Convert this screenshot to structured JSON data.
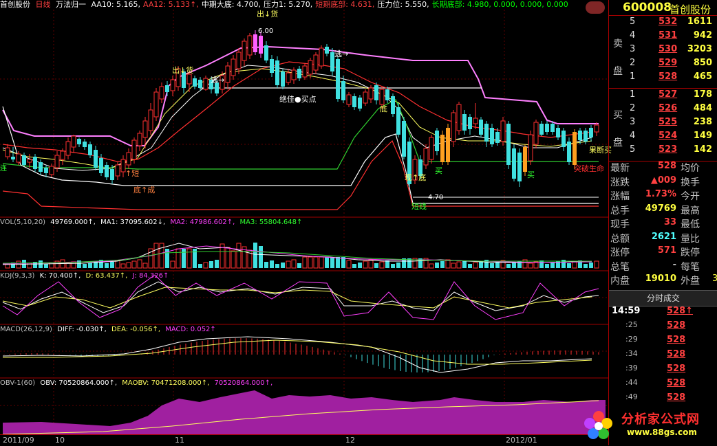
{
  "header": {
    "stock_name": "首创股份",
    "period": "日线",
    "indicator": "万法归一",
    "items": [
      {
        "label": "AA10: 5.165,",
        "color": "#ffffff"
      },
      {
        "label": "AA12: 5.133↑,",
        "color": "#ff4040"
      },
      {
        "label": "中期大底: 4.700,",
        "color": "#ffffff"
      },
      {
        "label": "压力1: 5.270,",
        "color": "#ffffff"
      },
      {
        "label": "短期底部: 4.631,",
        "color": "#ff4040"
      },
      {
        "label": "压力位: 5.550,",
        "color": "#ffffff"
      },
      {
        "label": "长期底部: 4.980, 0.000, 0.000, 0.000",
        "color": "#00ff00"
      }
    ]
  },
  "annotations": {
    "high_price": "6.00",
    "low_price": "4.70",
    "chu_huo_top": "出↓货",
    "chu_huo_left": "出↓货",
    "tao_1": "逃→",
    "tao_2": "逃→",
    "jue_jia": "绝佳●买点",
    "di_1": "底",
    "di_cheng": "底↑成",
    "zhen": "↑短",
    "di_2": "现↑底",
    "mai_1": "买",
    "mai_2": "买",
    "short_line": "短线",
    "guo_duan": "果断买",
    "tu_po": "突破生命",
    "left_edge": "连"
  },
  "vol_header": {
    "name": "VOL(5,10,20)",
    "value": "49769.000↑,",
    "ma1": "MA1: 37095.602↓,",
    "ma2": "MA2: 47986.602↑,",
    "ma3": "MA3: 55804.648↑"
  },
  "kdj_header": {
    "name": "KDJ(9,3,3)",
    "k": "K: 70.400↑,",
    "d": "D: 63.437↑,",
    "j": "J: 84.326↑"
  },
  "macd_header": {
    "name": "MACD(26,12,9)",
    "diff": "DIFF: -0.030↑,",
    "dea": "DEA: -0.056↑,",
    "macd": "MACD: 0.052↑"
  },
  "obv_header": {
    "name": "OBV-1(60)",
    "obv": "OBV: 70520864.000↑,",
    "maobv": "MAOBV: 70471208.000↑,",
    "extra": "70520864.000↑,"
  },
  "xaxis": {
    "labels": [
      "2011/09",
      "10",
      "11",
      "12",
      "2012/01"
    ]
  },
  "right_panel": {
    "code": "600008",
    "name": "首创股份",
    "sell_label_1": "卖",
    "sell_label_2": "盘",
    "buy_label_1": "买",
    "buy_label_2": "盘",
    "sell": [
      {
        "level": "5",
        "price": "532",
        "vol": "1611"
      },
      {
        "level": "4",
        "price": "531",
        "vol": "942"
      },
      {
        "level": "3",
        "price": "530",
        "vol": "3203"
      },
      {
        "level": "2",
        "price": "529",
        "vol": "850"
      },
      {
        "level": "1",
        "price": "528",
        "vol": "465"
      }
    ],
    "buy": [
      {
        "level": "1",
        "price": "527",
        "vol": "178"
      },
      {
        "level": "2",
        "price": "526",
        "vol": "484"
      },
      {
        "level": "3",
        "price": "525",
        "vol": "238"
      },
      {
        "level": "4",
        "price": "524",
        "vol": "149"
      },
      {
        "level": "5",
        "price": "523",
        "vol": "142"
      }
    ],
    "stats": [
      {
        "l1": "最新",
        "v1": "528",
        "c1": "#ff4040",
        "l2": "均价",
        "v2": ""
      },
      {
        "l1": "涨跌",
        "v1": "▲009",
        "c1": "#ff4040",
        "l2": "换手",
        "v2": ""
      },
      {
        "l1": "涨幅",
        "v1": "1.73%",
        "c1": "#ff4040",
        "l2": "今开",
        "v2": ""
      },
      {
        "l1": "总手",
        "v1": "49769",
        "c1": "#ffff40",
        "l2": "最高",
        "v2": ""
      },
      {
        "l1": "现手",
        "v1": "33",
        "c1": "#ff4040",
        "l2": "最低",
        "v2": ""
      },
      {
        "l1": "总额",
        "v1": "2621",
        "c1": "#50ffff",
        "l2": "量比",
        "v2": ""
      },
      {
        "l1": "涨停",
        "v1": "571",
        "c1": "#ff4040",
        "l2": "跌停",
        "v2": ""
      },
      {
        "l1": "总笔",
        "v1": "-",
        "c1": "#c0c0c0",
        "l2": "每笔",
        "v2": ""
      },
      {
        "l1": "内盘",
        "v1": "19010",
        "c1": "#ffff40",
        "l2": "外盘",
        "v2": "3"
      }
    ],
    "tab_label": "分时成交",
    "ticks": [
      {
        "time": "14:59",
        "price": "528",
        "arrow": "↑"
      },
      {
        "time": ":25",
        "price": "528",
        "arrow": ""
      },
      {
        "time": ":29",
        "price": "528",
        "arrow": ""
      },
      {
        "time": ":34",
        "price": "528",
        "arrow": ""
      },
      {
        "time": ":39",
        "price": "528",
        "arrow": ""
      },
      {
        "time": ":44",
        "price": "528",
        "arrow": ""
      },
      {
        "time": ":49",
        "price": "528",
        "arrow": ""
      }
    ],
    "logo_text": "分析家公式网",
    "logo_url": "www.88gs.com"
  }
}
